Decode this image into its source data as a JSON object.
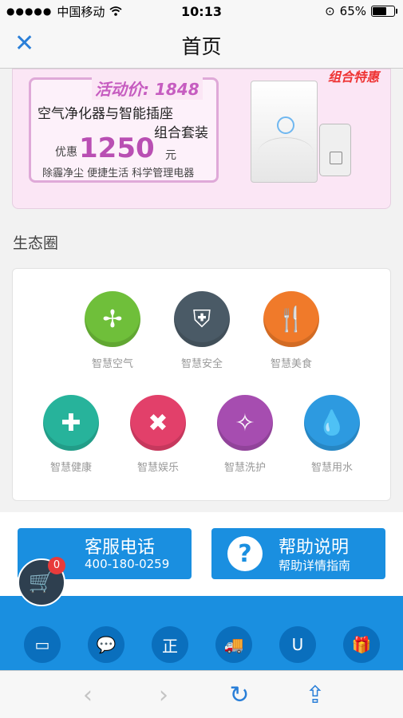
{
  "status_bar": {
    "signal": "●●●●●",
    "carrier": "中国移动",
    "wifi": "wifi-icon",
    "time": "10:13",
    "battery_pct": "65%",
    "battery_level": 0.65
  },
  "navbar": {
    "close_icon": "✕",
    "title": "首页"
  },
  "banner": {
    "price_label": "活动价: 1848",
    "product_line1": "空气净化器与智能插座",
    "product_line2": "组合套装",
    "discount_prefix": "优惠",
    "discount_amount": "1250",
    "discount_unit": "元",
    "description": "除霾净尘 便捷生活 科学管理电器",
    "corner_text": "组合特惠"
  },
  "section": {
    "title": "生态圈"
  },
  "eco_items": [
    {
      "label": "智慧空气",
      "glyph": "✢",
      "color": "#6fbf3a"
    },
    {
      "label": "智慧安全",
      "glyph": "⛨",
      "color": "#4a5a66"
    },
    {
      "label": "智慧美食",
      "glyph": "🍴",
      "color": "#f07a2a"
    },
    {
      "label": "智慧健康",
      "glyph": "✚",
      "color": "#27b39b"
    },
    {
      "label": "智慧娱乐",
      "glyph": "✖",
      "color": "#e2406a"
    },
    {
      "label": "智慧洗护",
      "glyph": "✧",
      "color": "#a64db0"
    },
    {
      "label": "智慧用水",
      "glyph": "💧",
      "color": "#2d9ae0"
    }
  ],
  "help": {
    "service_title": "客服电话",
    "service_phone": "400-180-0259",
    "help_title": "帮助说明",
    "help_sub": "帮助详情指南",
    "question_glyph": "?"
  },
  "cart": {
    "count": "0",
    "glyph": "🛒"
  },
  "footer_icons": [
    {
      "name": "card-icon",
      "glyph": "▭"
    },
    {
      "name": "chat-icon",
      "glyph": "💬"
    },
    {
      "name": "shield-zheng-icon",
      "glyph": "正"
    },
    {
      "name": "truck-icon",
      "glyph": "🚚"
    },
    {
      "name": "u-logo-icon",
      "glyph": "U"
    },
    {
      "name": "gift-icon",
      "glyph": "🎁"
    }
  ],
  "safari": {
    "back": "‹",
    "forward": "›",
    "reload": "↻",
    "share": "⇪"
  }
}
